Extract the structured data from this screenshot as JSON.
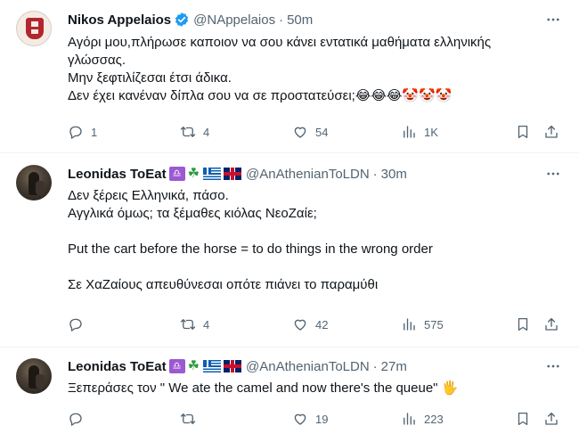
{
  "tweets": [
    {
      "author": {
        "name": "Nikos Appelaios",
        "handle": "@NAppelaios",
        "time": "50m",
        "verified": true
      },
      "text": "Αγόρι μου,πλήρωσε καποιον να σου κάνει εντατικά μαθήματα ελληνικής γλώσσας.\nΜην ξεφτιλίζεσαι έτσι άδικα.\nΔεν έχει κανέναν δίπλα σου να σε προστατεύσει;😂😂😂🤡🤡🤡",
      "stats": {
        "replies": "1",
        "reposts": "4",
        "likes": "54",
        "views": "1K"
      }
    },
    {
      "author": {
        "name": "Leonidas ToEat",
        "name_emojis": "♎☘️",
        "handle": "@AnAthenianToLDN",
        "time": "30m"
      },
      "text": "Δεν ξέρεις Ελληνικά, πάσο.\nΑγγλικά όμως; τα ξέμαθες κιόλας ΝεοΖαίε;\n\nPut the cart before the horse = to do things in the wrong order\n\nΣε ΧαΖαίους απευθύνεσαι οπότε πιάνει το παραμύθι",
      "stats": {
        "replies": "",
        "reposts": "4",
        "likes": "42",
        "views": "575"
      }
    },
    {
      "author": {
        "name": "Leonidas ToEat",
        "name_emojis": "♎☘️",
        "handle": "@AnAthenianToLDN",
        "time": "27m"
      },
      "text": "Ξεπεράσες τον \" We ate the camel and now there's the queue\" 🖐",
      "stats": {
        "replies": "",
        "reposts": "",
        "likes": "19",
        "views": "223"
      }
    }
  ],
  "ui": {
    "separator": "·",
    "verified_color": "#1d9bf0"
  }
}
